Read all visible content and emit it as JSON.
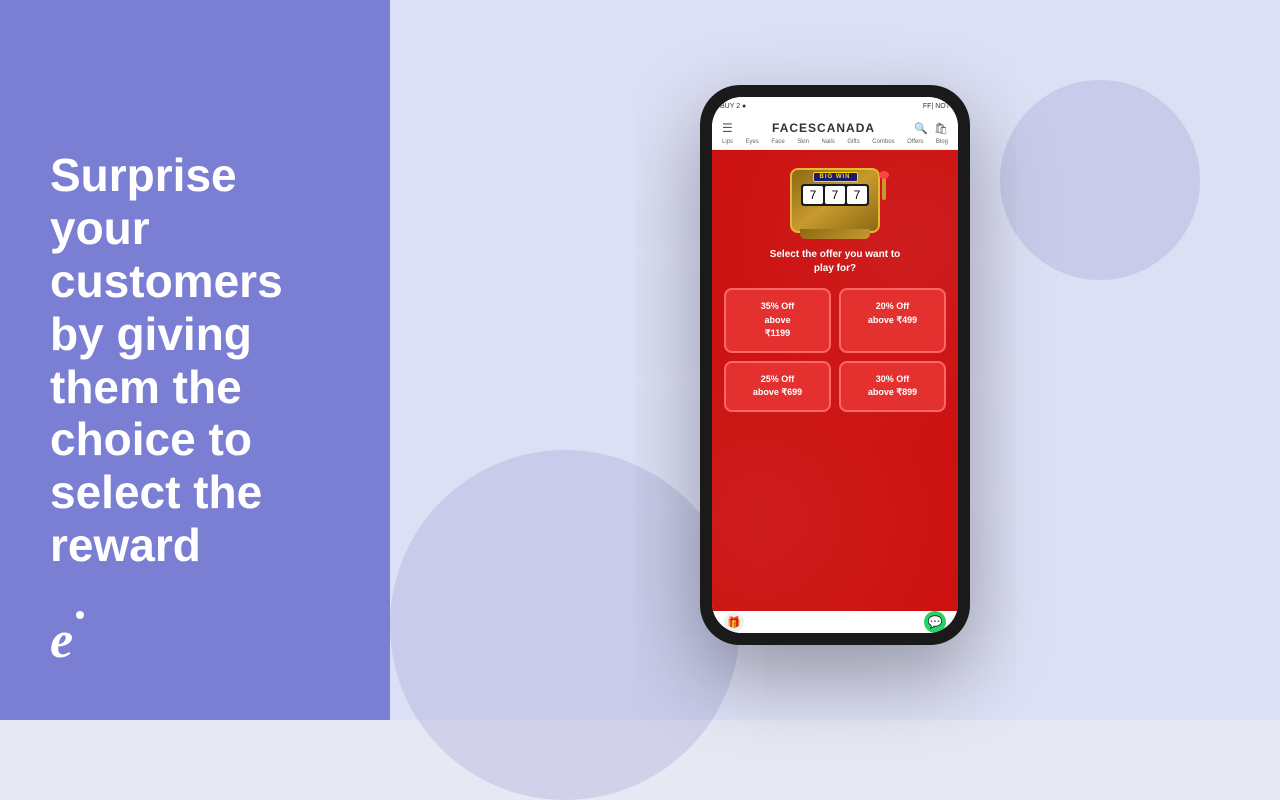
{
  "left": {
    "headline": "Surprise your customers by giving them the choice to select the reward",
    "logo_letter": "e"
  },
  "right": {
    "circle_decor": true
  },
  "phone": {
    "status_bar": {
      "left": "BUY 2 ●",
      "right": "FF| NOT"
    },
    "nav": {
      "brand": "FACESCANADA",
      "menu_items": [
        "Lips",
        "Eyes",
        "Face",
        "Skin",
        "Nails",
        "Gifts",
        "Combos",
        "Offers",
        "Blog"
      ]
    },
    "promo": {
      "slot": {
        "big_win": "BIG WIN",
        "reels": [
          "🎰",
          "🎰",
          "🎰"
        ],
        "reel_symbols": [
          "7",
          "7",
          "7"
        ]
      },
      "select_text": "Select the offer you want to\nplay for?",
      "offers": [
        {
          "label": "35% Off\nabove\n₹1199"
        },
        {
          "label": "20% Off\nabove ₹499"
        },
        {
          "label": "25% Off\nabove ₹699"
        },
        {
          "label": "30% Off\nabove ₹899"
        }
      ]
    }
  }
}
